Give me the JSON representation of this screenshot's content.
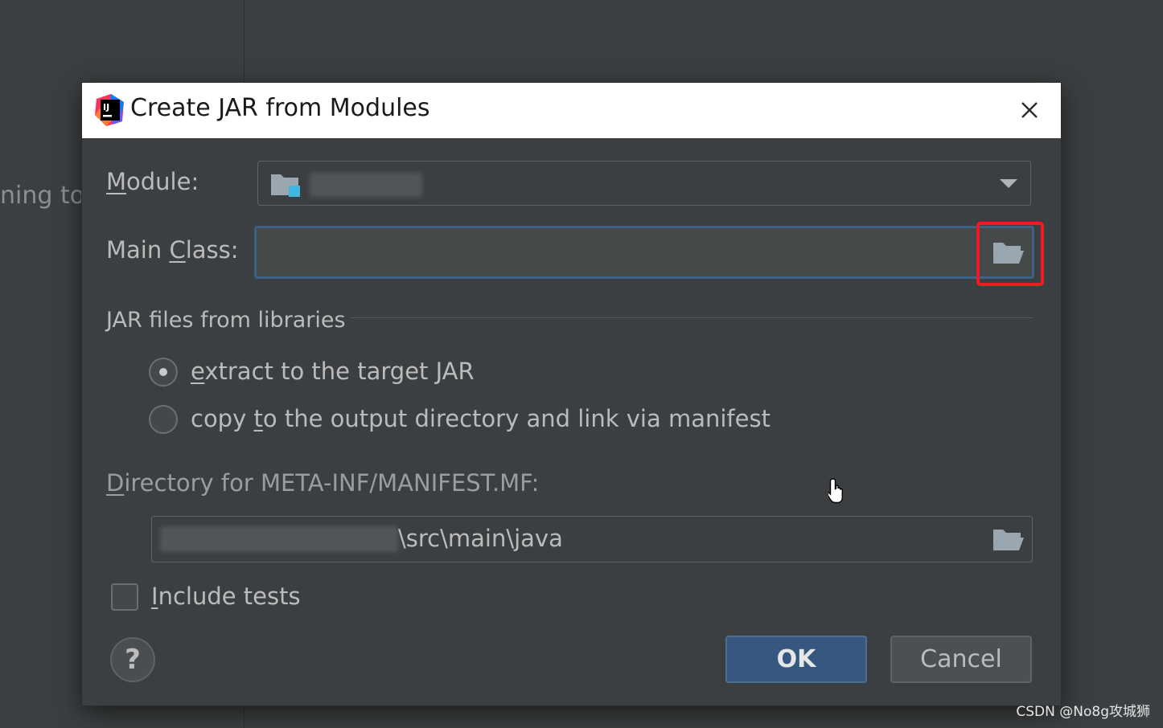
{
  "background": {
    "partial_text": "ning to"
  },
  "dialog": {
    "title": "Create JAR from Modules",
    "module": {
      "label_pre": "",
      "label_ul": "M",
      "label_post": "odule:",
      "value": ""
    },
    "main_class": {
      "label_pre": "Main ",
      "label_ul": "C",
      "label_post": "lass:",
      "value": ""
    },
    "libraries_group": {
      "title": "JAR files from libraries",
      "options": [
        {
          "label_pre": "",
          "label_ul": "e",
          "label_post": "xtract to the target JAR",
          "selected": true
        },
        {
          "label_pre": "copy ",
          "label_ul": "t",
          "label_post": "o the output directory and link via manifest",
          "selected": false
        }
      ]
    },
    "manifest_dir": {
      "label_pre": "",
      "label_ul": "D",
      "label_post": "irectory for META-INF/MANIFEST.MF:",
      "value_visible": "\\src\\main\\java"
    },
    "include_tests": {
      "label_pre": "",
      "label_ul": "I",
      "label_post": "nclude tests",
      "checked": false
    },
    "help_label": "?",
    "ok_label": "OK",
    "cancel_label": "Cancel"
  },
  "watermark": "CSDN @No8g攻城狮",
  "colors": {
    "background": "#3c3f41",
    "accent": "#365880",
    "highlight": "#ee1b24",
    "title_bar": "#ffffff"
  },
  "icons": {
    "app": "intellij-idea-icon",
    "close": "close-icon",
    "module": "module-folder-icon",
    "dropdown": "chevron-down-icon",
    "browse": "open-folder-icon",
    "help": "help-icon",
    "cursor": "hand-pointer-icon"
  }
}
